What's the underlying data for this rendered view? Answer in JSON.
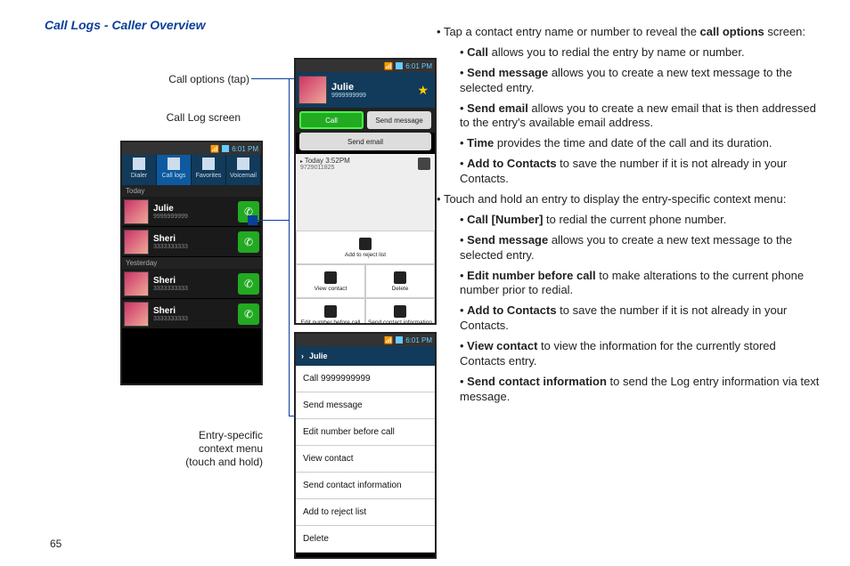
{
  "section_title": "Call Logs - Caller Overview",
  "captions": {
    "call_options": "Call options (tap)",
    "call_log": "Call Log screen",
    "entry_ctx_l1": "Entry-specific",
    "entry_ctx_l2": "context menu",
    "entry_ctx_l3": "(touch and hold)"
  },
  "status_time": "6:01 PM",
  "tabs": {
    "dialer": "Dialer",
    "calllogs": "Call logs",
    "favorites": "Favorites",
    "voicemail": "Voicemail"
  },
  "calllog": {
    "today": "Today",
    "yesterday": "Yesterday",
    "rows": [
      {
        "name": "Julie",
        "num": "9999999999"
      },
      {
        "name": "Sheri",
        "num": "3333333333"
      },
      {
        "name": "Sheri",
        "num": "3333333333"
      },
      {
        "name": "Sheri",
        "num": "3333333333"
      }
    ]
  },
  "callopt": {
    "name": "Julie",
    "sub_num": "9999999999",
    "call": "Call",
    "send_msg": "Send message",
    "send_email": "Send email",
    "today_label": "Today 3:52PM",
    "today_num": "9729011825",
    "grid": {
      "reject": "Add to reject list",
      "view": "View contact",
      "delete": "Delete",
      "edit": "Edit number before call",
      "sendinfo": "Send contact information"
    }
  },
  "ctxmenu": {
    "header": "Julie",
    "items": [
      "Call 9999999999",
      "Send message",
      "Edit number before call",
      "View contact",
      "Send contact information",
      "Add to reject list",
      "Delete"
    ]
  },
  "right": {
    "l1a": "Tap a contact entry name or number to reveal the ",
    "l1a_b": "call options",
    "l1a_end": " screen:",
    "call_b": "Call",
    "call_t": " allows you to redial the entry by name or number.",
    "smsg_b": "Send message",
    "smsg_t": " allows you to create a new text message to the selected entry.",
    "semail_b": "Send email",
    "semail_t": " allows you to create a new email that is then addressed to the entry's available email address.",
    "time_b": "Time",
    "time_t": " provides the time and date of the call and its duration.",
    "atc_b": "Add to Contacts",
    "atc_t": " to save the number if it is not already in your Contacts.",
    "l1b": "Touch and hold an entry to display the entry-specific context menu:",
    "cnum_b": "Call [Number]",
    "cnum_t": " to redial the current phone number.",
    "smsg2_b": "Send message",
    "smsg2_t": " allows you to create a new text message to the selected entry.",
    "edit_b": "Edit number before call",
    "edit_t": " to make alterations to the current phone number prior to redial.",
    "atc2_b": "Add to Contacts",
    "atc2_t": " to save the number if it is not already in your Contacts.",
    "view_b": "View contact",
    "view_t": " to view the information for the currently stored Contacts entry.",
    "sci_b": "Send contact information",
    "sci_t": " to send the Log entry information via text message."
  },
  "page_number": "65"
}
